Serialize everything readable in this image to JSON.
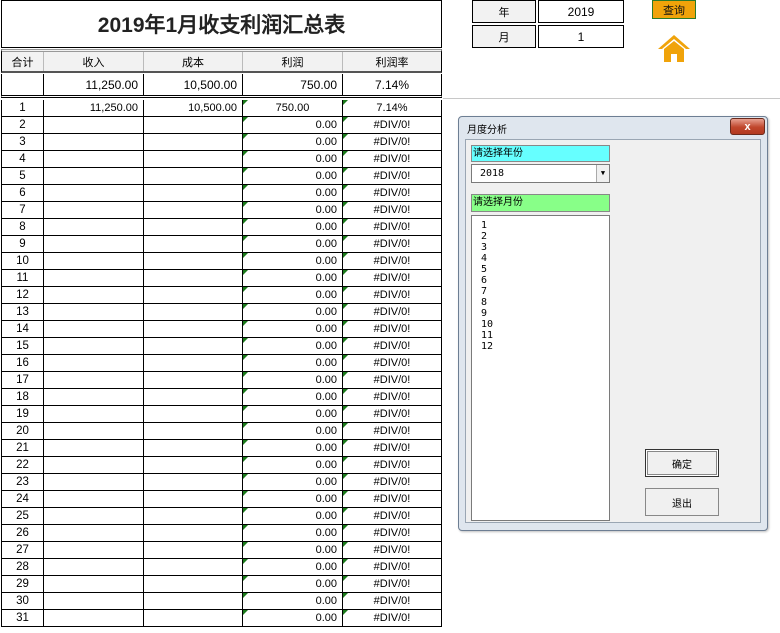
{
  "sheet": {
    "title": "2019年1月收支利润汇总表",
    "headers": [
      "合计",
      "收入",
      "成本",
      "利润",
      "利润率"
    ],
    "total": {
      "label": "",
      "income": "11,250.00",
      "cost": "10,500.00",
      "profit": "750.00",
      "rate": "7.14%"
    },
    "rows": [
      {
        "n": "1",
        "income": "11,250.00",
        "cost": "10,500.00",
        "profit": "750.00",
        "rate": "7.14%"
      },
      {
        "n": "2",
        "income": "",
        "cost": "",
        "profit": "0.00",
        "rate": "#DIV/0!"
      },
      {
        "n": "3",
        "income": "",
        "cost": "",
        "profit": "0.00",
        "rate": "#DIV/0!"
      },
      {
        "n": "4",
        "income": "",
        "cost": "",
        "profit": "0.00",
        "rate": "#DIV/0!"
      },
      {
        "n": "5",
        "income": "",
        "cost": "",
        "profit": "0.00",
        "rate": "#DIV/0!"
      },
      {
        "n": "6",
        "income": "",
        "cost": "",
        "profit": "0.00",
        "rate": "#DIV/0!"
      },
      {
        "n": "7",
        "income": "",
        "cost": "",
        "profit": "0.00",
        "rate": "#DIV/0!"
      },
      {
        "n": "8",
        "income": "",
        "cost": "",
        "profit": "0.00",
        "rate": "#DIV/0!"
      },
      {
        "n": "9",
        "income": "",
        "cost": "",
        "profit": "0.00",
        "rate": "#DIV/0!"
      },
      {
        "n": "10",
        "income": "",
        "cost": "",
        "profit": "0.00",
        "rate": "#DIV/0!"
      },
      {
        "n": "11",
        "income": "",
        "cost": "",
        "profit": "0.00",
        "rate": "#DIV/0!"
      },
      {
        "n": "12",
        "income": "",
        "cost": "",
        "profit": "0.00",
        "rate": "#DIV/0!"
      },
      {
        "n": "13",
        "income": "",
        "cost": "",
        "profit": "0.00",
        "rate": "#DIV/0!"
      },
      {
        "n": "14",
        "income": "",
        "cost": "",
        "profit": "0.00",
        "rate": "#DIV/0!"
      },
      {
        "n": "15",
        "income": "",
        "cost": "",
        "profit": "0.00",
        "rate": "#DIV/0!"
      },
      {
        "n": "16",
        "income": "",
        "cost": "",
        "profit": "0.00",
        "rate": "#DIV/0!"
      },
      {
        "n": "17",
        "income": "",
        "cost": "",
        "profit": "0.00",
        "rate": "#DIV/0!"
      },
      {
        "n": "18",
        "income": "",
        "cost": "",
        "profit": "0.00",
        "rate": "#DIV/0!"
      },
      {
        "n": "19",
        "income": "",
        "cost": "",
        "profit": "0.00",
        "rate": "#DIV/0!"
      },
      {
        "n": "20",
        "income": "",
        "cost": "",
        "profit": "0.00",
        "rate": "#DIV/0!"
      },
      {
        "n": "21",
        "income": "",
        "cost": "",
        "profit": "0.00",
        "rate": "#DIV/0!"
      },
      {
        "n": "22",
        "income": "",
        "cost": "",
        "profit": "0.00",
        "rate": "#DIV/0!"
      },
      {
        "n": "23",
        "income": "",
        "cost": "",
        "profit": "0.00",
        "rate": "#DIV/0!"
      },
      {
        "n": "24",
        "income": "",
        "cost": "",
        "profit": "0.00",
        "rate": "#DIV/0!"
      },
      {
        "n": "25",
        "income": "",
        "cost": "",
        "profit": "0.00",
        "rate": "#DIV/0!"
      },
      {
        "n": "26",
        "income": "",
        "cost": "",
        "profit": "0.00",
        "rate": "#DIV/0!"
      },
      {
        "n": "27",
        "income": "",
        "cost": "",
        "profit": "0.00",
        "rate": "#DIV/0!"
      },
      {
        "n": "28",
        "income": "",
        "cost": "",
        "profit": "0.00",
        "rate": "#DIV/0!"
      },
      {
        "n": "29",
        "income": "",
        "cost": "",
        "profit": "0.00",
        "rate": "#DIV/0!"
      },
      {
        "n": "30",
        "income": "",
        "cost": "",
        "profit": "0.00",
        "rate": "#DIV/0!"
      },
      {
        "n": "31",
        "income": "",
        "cost": "",
        "profit": "0.00",
        "rate": "#DIV/0!"
      }
    ]
  },
  "controls": {
    "year_label": "年",
    "year_value": "2019",
    "month_label": "月",
    "month_value": "1",
    "query_label": "查询",
    "home_icon": "home-icon",
    "accent_color": "#f0a30a"
  },
  "dialog": {
    "title": "月度分析",
    "close_label": "x",
    "year_prompt": "请选择年份",
    "year_selected": "2018",
    "month_prompt": "请选择月份",
    "months": [
      "1",
      "2",
      "3",
      "4",
      "5",
      "6",
      "7",
      "8",
      "9",
      "10",
      "11",
      "12"
    ],
    "ok_label": "确定",
    "exit_label": "退出"
  }
}
